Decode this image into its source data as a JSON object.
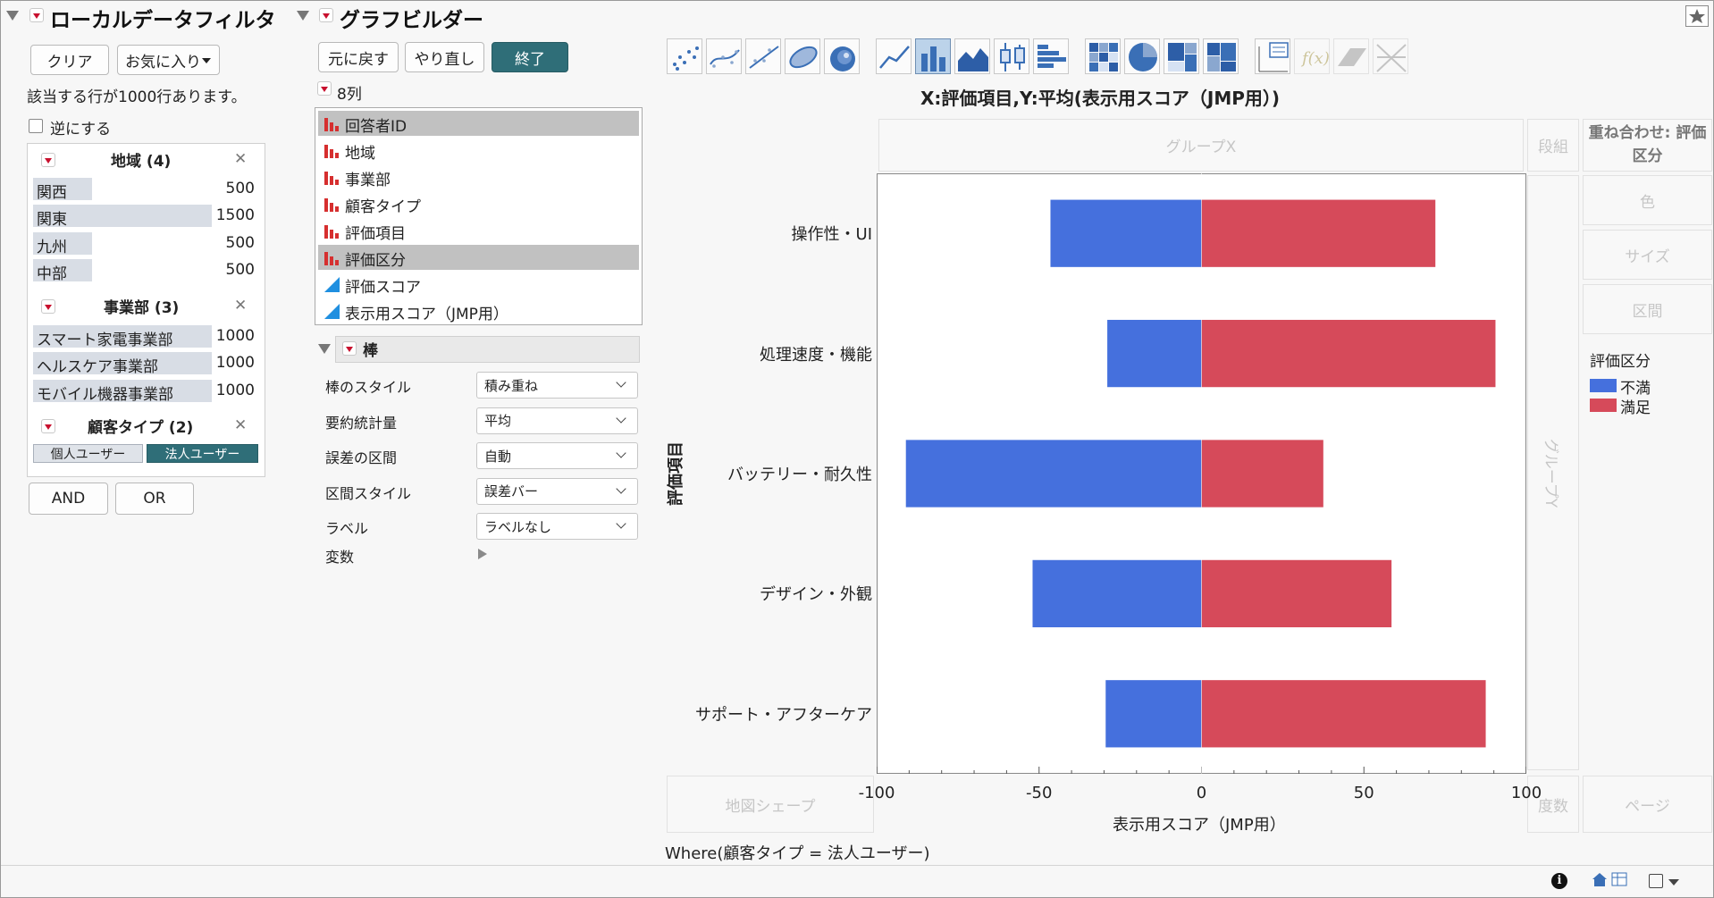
{
  "filter": {
    "title": "ローカルデータフィルタ",
    "clear_label": "クリア",
    "favorites_label": "お気に入り",
    "row_count_text": "該当する行が1000行あります。",
    "invert_label": "逆にする",
    "region": {
      "title": "地域 (4)",
      "items": [
        {
          "label": "関西",
          "count": "500",
          "frac": 0.33
        },
        {
          "label": "関東",
          "count": "1500",
          "frac": 1.0
        },
        {
          "label": "九州",
          "count": "500",
          "frac": 0.33
        },
        {
          "label": "中部",
          "count": "500",
          "frac": 0.33
        }
      ]
    },
    "division": {
      "title": "事業部 (3)",
      "items": [
        {
          "label": "スマート家電事業部",
          "count": "1000",
          "frac": 1.0
        },
        {
          "label": "ヘルスケア事業部",
          "count": "1000",
          "frac": 1.0
        },
        {
          "label": "モバイル機器事業部",
          "count": "1000",
          "frac": 1.0
        }
      ]
    },
    "customer": {
      "title": "顧客タイプ (2)",
      "options": [
        "個人ユーザー",
        "法人ユーザー"
      ],
      "selected": "法人ユーザー"
    },
    "and_label": "AND",
    "or_label": "OR"
  },
  "builder": {
    "title": "グラフビルダー",
    "undo_label": "元に戻す",
    "redo_label": "やり直し",
    "done_label": "終了",
    "columns_count": "8列",
    "columns": [
      {
        "name": "回答者ID",
        "type": "nominal",
        "selected": true
      },
      {
        "name": "地域",
        "type": "nominal",
        "selected": false
      },
      {
        "name": "事業部",
        "type": "nominal",
        "selected": false
      },
      {
        "name": "顧客タイプ",
        "type": "nominal",
        "selected": false
      },
      {
        "name": "評価項目",
        "type": "nominal",
        "selected": false
      },
      {
        "name": "評価区分",
        "type": "nominal",
        "selected": true
      },
      {
        "name": "評価スコア",
        "type": "continuous",
        "selected": false
      },
      {
        "name": "表示用スコア（JMP用）",
        "type": "continuous",
        "selected": false
      }
    ],
    "bar_section_title": "棒",
    "properties": [
      {
        "label": "棒のスタイル",
        "value": "積み重ね"
      },
      {
        "label": "要約統計量",
        "value": "平均"
      },
      {
        "label": "誤差の区間",
        "value": "自動"
      },
      {
        "label": "区間スタイル",
        "value": "誤差バー"
      },
      {
        "label": "ラベル",
        "value": "ラベルなし"
      }
    ],
    "variables_label": "変数",
    "where_text": "Where(顧客タイプ = 法人ユーザー)"
  },
  "zones": {
    "group_x": "グループX",
    "group_y": "グループY",
    "wrap": "段組",
    "overlay": "重ね合わせ: 評価区分",
    "color": "色",
    "size": "サイズ",
    "interval": "区間",
    "map_shape": "地図シェープ",
    "freq": "度数",
    "page": "ページ"
  },
  "chart_data": {
    "type": "bar",
    "orientation": "horizontal",
    "stacked": true,
    "title": "X:評価項目,Y:平均(表示用スコア（JMP用）)",
    "categories": [
      "操作性・UI",
      "処理速度・機能",
      "バッテリー・耐久性",
      "デザイン・外観",
      "サポート・アフターケア"
    ],
    "series": [
      {
        "name": "不満",
        "color": "#4570dd",
        "values": [
          -46.5,
          -29,
          -91,
          -52,
          -29.5
        ]
      },
      {
        "name": "満足",
        "color": "#d64a5a",
        "values": [
          72,
          90.5,
          37.5,
          58.5,
          87.5
        ]
      }
    ],
    "xlabel": "表示用スコア（JMP用）",
    "ylabel": "評価項目",
    "xlim": [
      -100,
      100
    ],
    "xticks": [
      "-100",
      "-50",
      "0",
      "50",
      "100"
    ],
    "legend_title": "評価区分",
    "legend_position": "right"
  }
}
